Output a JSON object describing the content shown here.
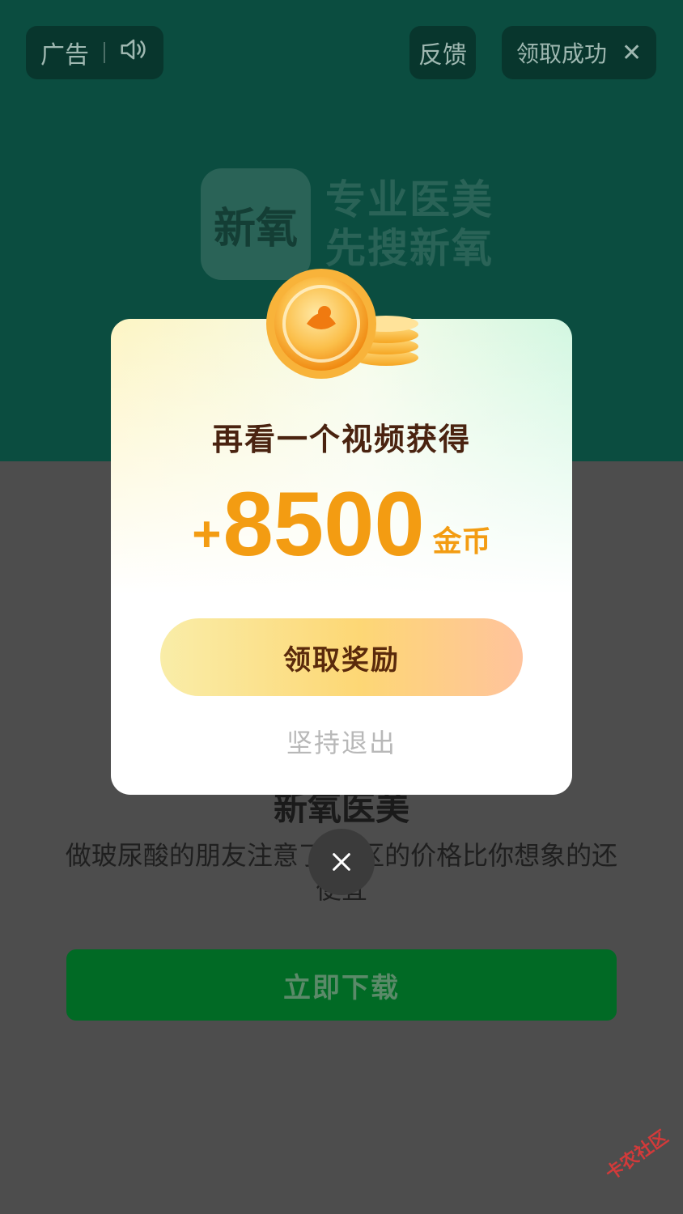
{
  "ad": {
    "label": "广告",
    "feedback": "反馈",
    "success": "领取成功",
    "brand_logo": "新氧",
    "slogan_line1": "专业医美",
    "slogan_line2": "先搜新氧",
    "app_title": "新氧医美",
    "description": "做玻尿酸的朋友注意了 本区的价格比你想象的还便宜",
    "download": "立即下载"
  },
  "modal": {
    "heading": "再看一个视频获得",
    "plus": "+",
    "amount": "8500",
    "unit": "金币",
    "claim": "领取奖励",
    "quit": "坚持退出"
  },
  "watermark": "卡农社区",
  "icons": [
    "speaker-icon",
    "close-icon",
    "coin-icon"
  ],
  "colors": {
    "accent": "#f39c12",
    "ad_bg": "#0b4d40",
    "download_btn": "#016a25"
  }
}
